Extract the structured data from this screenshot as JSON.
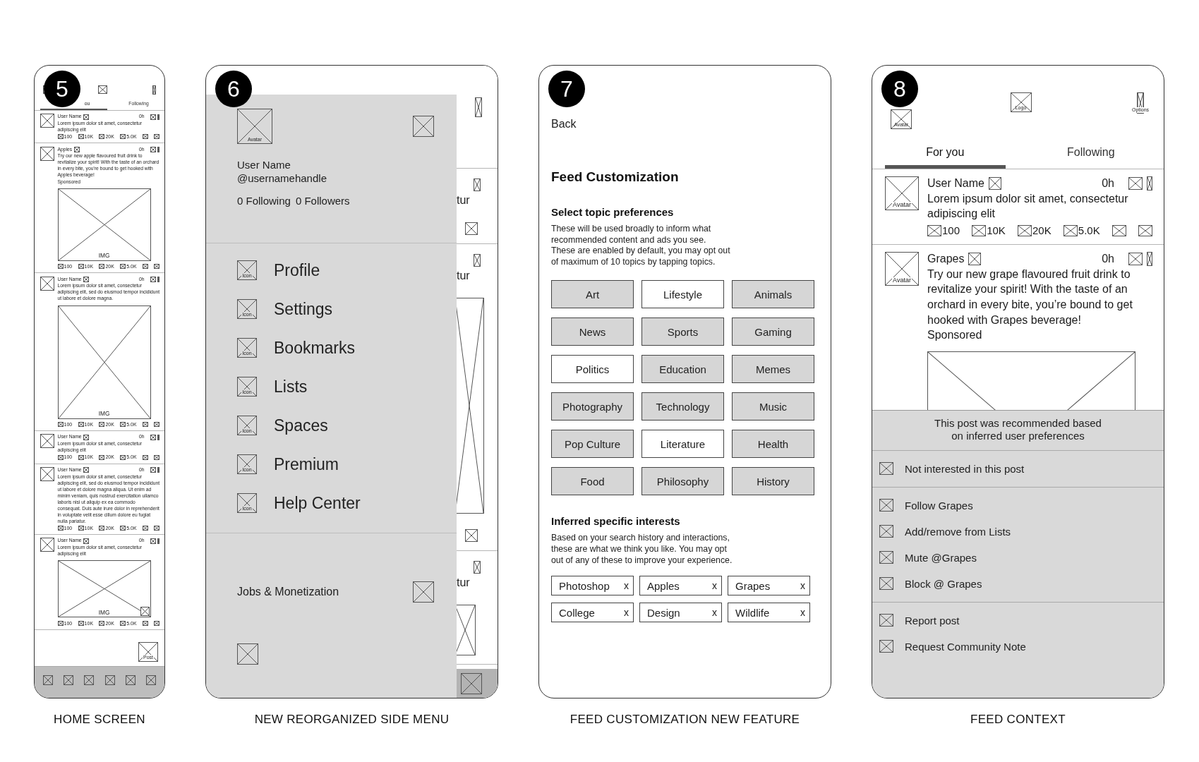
{
  "screens": [
    {
      "kind": "home",
      "badge": "5",
      "caption": "HOME SCREEN",
      "tabs": [
        {
          "label": "ou",
          "selected": true
        },
        {
          "label": "Following",
          "selected": false
        }
      ],
      "posts": [
        {
          "author": "User Name",
          "time": "0h",
          "text": "Lorem ipsum dolor sit amet, consectetur adipiscing elit",
          "stats": [
            "100",
            "10K",
            "20K",
            "5.0K"
          ]
        },
        {
          "author": "Apples",
          "time": "0h",
          "text": "Try our new apple flavoured fruit drink to revitalize your spirit! With the taste of an orchard in every bite, you’re bound to get hooked with Apples beverage!",
          "sponsored": "Sponsored",
          "image": {
            "kind": "medium",
            "label": "IMG"
          },
          "stats": [
            "100",
            "10K",
            "20K",
            "5.0K"
          ]
        },
        {
          "author": "User Name",
          "time": "0h",
          "text": "Lorem ipsum dolor sit amet, consectetur adipiscing elit, sed do eiusmod tempor incididunt ut labore et dolore magna.",
          "image": {
            "kind": "tall",
            "label": "IMG"
          },
          "stats": [
            "100",
            "10K",
            "20K",
            "5.0K"
          ]
        },
        {
          "author": "User Name",
          "time": "0h",
          "text": "Lorem ipsum dolor sit amet, consectetur adipiscing elit",
          "stats": [
            "100",
            "10K",
            "20K",
            "5.0K"
          ]
        },
        {
          "author": "User Name",
          "time": "0h",
          "text": "Lorem ipsum dolor sit amet, consectetur adipiscing elit, sed do eiusmod tempor incididunt ut labore et dolore magna aliqua. Ut enim ad minim veniam, quis nostrud exercitation ullamco laboris nisi ut aliquip ex ea commodo consequat. Duis aute irure dolor in reprehenderit in voluptate velit esse cillum dolore eu fugiat nulla pariatur.",
          "stats": [
            "100",
            "10K",
            "20K",
            "5.0K"
          ]
        },
        {
          "author": "User Name",
          "time": "0h",
          "text": "Lorem ipsum dolor sit amet, consectetur adipiscing elit",
          "image": {
            "kind": "short",
            "label": "IMG",
            "corner_icon": true
          },
          "stats": [
            "100",
            "10K",
            "20K",
            "5.0K"
          ]
        }
      ],
      "post_button": "Post"
    },
    {
      "kind": "menu",
      "badge": "6",
      "caption": "NEW REORGANIZED SIDE MENU",
      "profile": {
        "avatar": "Avatar",
        "name": "User Name",
        "handle": "@usernamehandle",
        "following": "0 Following",
        "followers": "0 Followers"
      },
      "menu_items": [
        {
          "label": "Profile",
          "icon": "Icon"
        },
        {
          "label": "Settings",
          "icon": "Icon"
        },
        {
          "label": "Bookmarks",
          "icon": "Icon"
        },
        {
          "label": "Lists",
          "icon": "Icon"
        },
        {
          "label": "Spaces",
          "icon": "Icon"
        },
        {
          "label": "Premium",
          "icon": "Icon"
        },
        {
          "label": "Help Center",
          "icon": "Icon"
        }
      ],
      "footer_item": "Jobs & Monetization",
      "peek_texts": [
        "tur",
        "tur",
        "tur"
      ]
    },
    {
      "kind": "custom",
      "badge": "7",
      "caption": "FEED CUSTOMIZATION NEW FEATURE",
      "back": "Back",
      "title": "Feed Customization",
      "topics_heading": "Select topic preferences",
      "topics_note": "These will be used broadly to inform what\nrecommended content and ads you see.\nThese are enabled by default, you may opt out\nof maximum of 10 topics by tapping topics.",
      "topics": [
        {
          "label": "Art",
          "selected": true
        },
        {
          "label": "Lifestyle",
          "selected": false
        },
        {
          "label": "Animals",
          "selected": true
        },
        {
          "label": "News",
          "selected": true
        },
        {
          "label": "Sports",
          "selected": true
        },
        {
          "label": "Gaming",
          "selected": true
        },
        {
          "label": "Politics",
          "selected": false
        },
        {
          "label": "Education",
          "selected": true
        },
        {
          "label": "Memes",
          "selected": true
        },
        {
          "label": "Photography",
          "selected": true
        },
        {
          "label": "Technology",
          "selected": true
        },
        {
          "label": "Music",
          "selected": true
        },
        {
          "label": "Pop Culture",
          "selected": true
        },
        {
          "label": "Literature",
          "selected": false
        },
        {
          "label": "Health",
          "selected": true
        },
        {
          "label": "Food",
          "selected": true
        },
        {
          "label": "Philosophy",
          "selected": true
        },
        {
          "label": "History",
          "selected": true
        }
      ],
      "interests_heading": "Inferred specific interests",
      "interests_note": "Based on your search history and interactions,\nthese are what we think you like. You may opt\nout of any of these to improve your experience.",
      "interests": [
        {
          "label": "Photoshop",
          "remove": "x"
        },
        {
          "label": "Apples",
          "remove": "x"
        },
        {
          "label": "Grapes",
          "remove": "x"
        },
        {
          "label": "College",
          "remove": "x"
        },
        {
          "label": "Design",
          "remove": "x"
        },
        {
          "label": "Wildlife",
          "remove": "x"
        }
      ]
    },
    {
      "kind": "context",
      "badge": "8",
      "caption": "FEED CONTEXT",
      "header": {
        "avatar": "Avatar",
        "logo": "Logo",
        "options": "Options"
      },
      "tabs": [
        {
          "label": "For you",
          "selected": true
        },
        {
          "label": "Following",
          "selected": false
        }
      ],
      "posts": [
        {
          "author": "User Name",
          "avatar": "Avatar",
          "time": "0h",
          "text": "Lorem ipsum dolor sit amet, consectetur adipiscing elit",
          "stats": [
            "100",
            "10K",
            "20K",
            "5.0K"
          ]
        },
        {
          "author": "Grapes",
          "avatar": "Avatar",
          "time": "0h",
          "text": "Try our new grape flavoured fruit drink to revitalize your spirit! With the taste of an orchard in every bite, you’re bound to get hooked with Grapes beverage!",
          "sponsored": "Sponsored",
          "image": {
            "kind": "cut"
          }
        }
      ],
      "notice": "This post was recommended based\non inferred user preferences",
      "menu_groups": [
        {
          "items": [
            "Not interested in this post"
          ]
        },
        {
          "items": [
            "Follow Grapes",
            "Add/remove from Lists",
            "Mute @Grapes",
            "Block @ Grapes"
          ]
        },
        {
          "items": [
            "Report post",
            "Request Community Note"
          ]
        }
      ]
    }
  ]
}
